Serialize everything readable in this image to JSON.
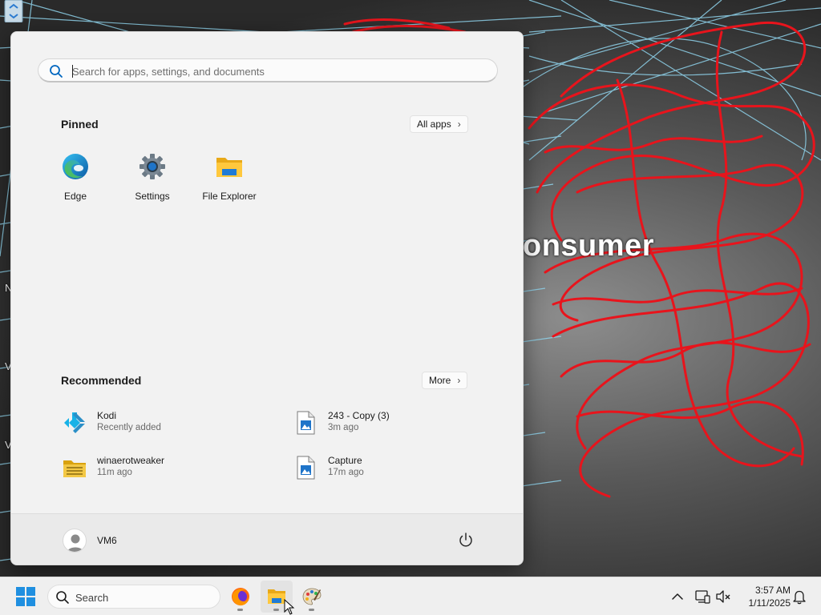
{
  "wallpaper": {
    "text": "onsumer",
    "edge_letters": [
      "N",
      "V",
      "V"
    ]
  },
  "start_menu": {
    "search": {
      "placeholder": "Search for apps, settings, and documents",
      "value": ""
    },
    "pinned": {
      "title": "Pinned",
      "all_apps_label": "All apps",
      "apps": [
        {
          "label": "Edge",
          "icon": "edge-icon"
        },
        {
          "label": "Settings",
          "icon": "gear-icon"
        },
        {
          "label": "File Explorer",
          "icon": "folder-icon"
        }
      ]
    },
    "recommended": {
      "title": "Recommended",
      "more_label": "More",
      "items": [
        {
          "name": "Kodi",
          "sub": "Recently added",
          "icon": "kodi-icon"
        },
        {
          "name": "243 - Copy (3)",
          "sub": "3m ago",
          "icon": "image-file-icon"
        },
        {
          "name": "winaerotweaker",
          "sub": "11m ago",
          "icon": "zip-folder-icon"
        },
        {
          "name": "Capture",
          "sub": "17m ago",
          "icon": "image-file-icon"
        }
      ]
    },
    "user": {
      "name": "VM6"
    }
  },
  "taskbar": {
    "search_label": "Search",
    "apps": [
      "firefox-icon",
      "file-explorer-icon",
      "paint-icon"
    ],
    "clock": {
      "time": "3:57 AM",
      "date": "1/11/2025"
    }
  },
  "colors": {
    "accent": "#0067c0",
    "scribble_red": "#e8141c",
    "line_cyan": "#8fd3ec",
    "menu_bg": "#f2f2f2",
    "taskbar_bg": "#efefef"
  }
}
